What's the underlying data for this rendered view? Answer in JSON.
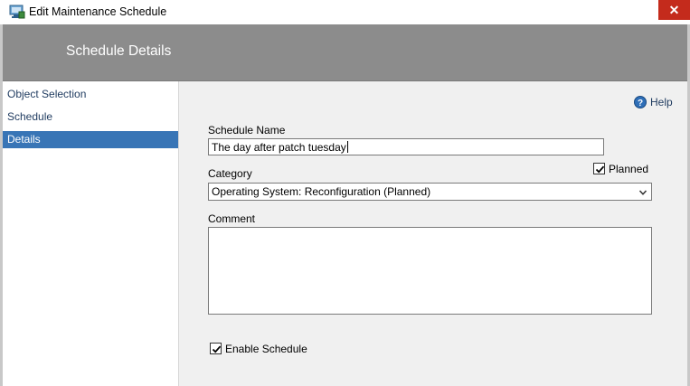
{
  "window": {
    "title": "Edit Maintenance Schedule",
    "close_glyph": "✕"
  },
  "header": {
    "title": "Schedule Details"
  },
  "nav": {
    "items": [
      {
        "label": "Object Selection",
        "selected": false
      },
      {
        "label": "Schedule",
        "selected": false
      },
      {
        "label": "Details",
        "selected": true
      }
    ]
  },
  "help": {
    "label": "Help",
    "icon": "help-icon"
  },
  "form": {
    "schedule_name": {
      "label": "Schedule Name",
      "value": "The day after patch tuesday"
    },
    "category": {
      "label": "Category",
      "selected": "Operating System: Reconfiguration (Planned)"
    },
    "planned": {
      "label": "Planned",
      "checked": true
    },
    "comment": {
      "label": "Comment",
      "value": ""
    },
    "enable_schedule": {
      "label": "Enable Schedule",
      "checked": true
    }
  },
  "colors": {
    "header_bg": "#8c8c8c",
    "nav_selected": "#3875b6",
    "close_bg": "#c42b1c"
  }
}
